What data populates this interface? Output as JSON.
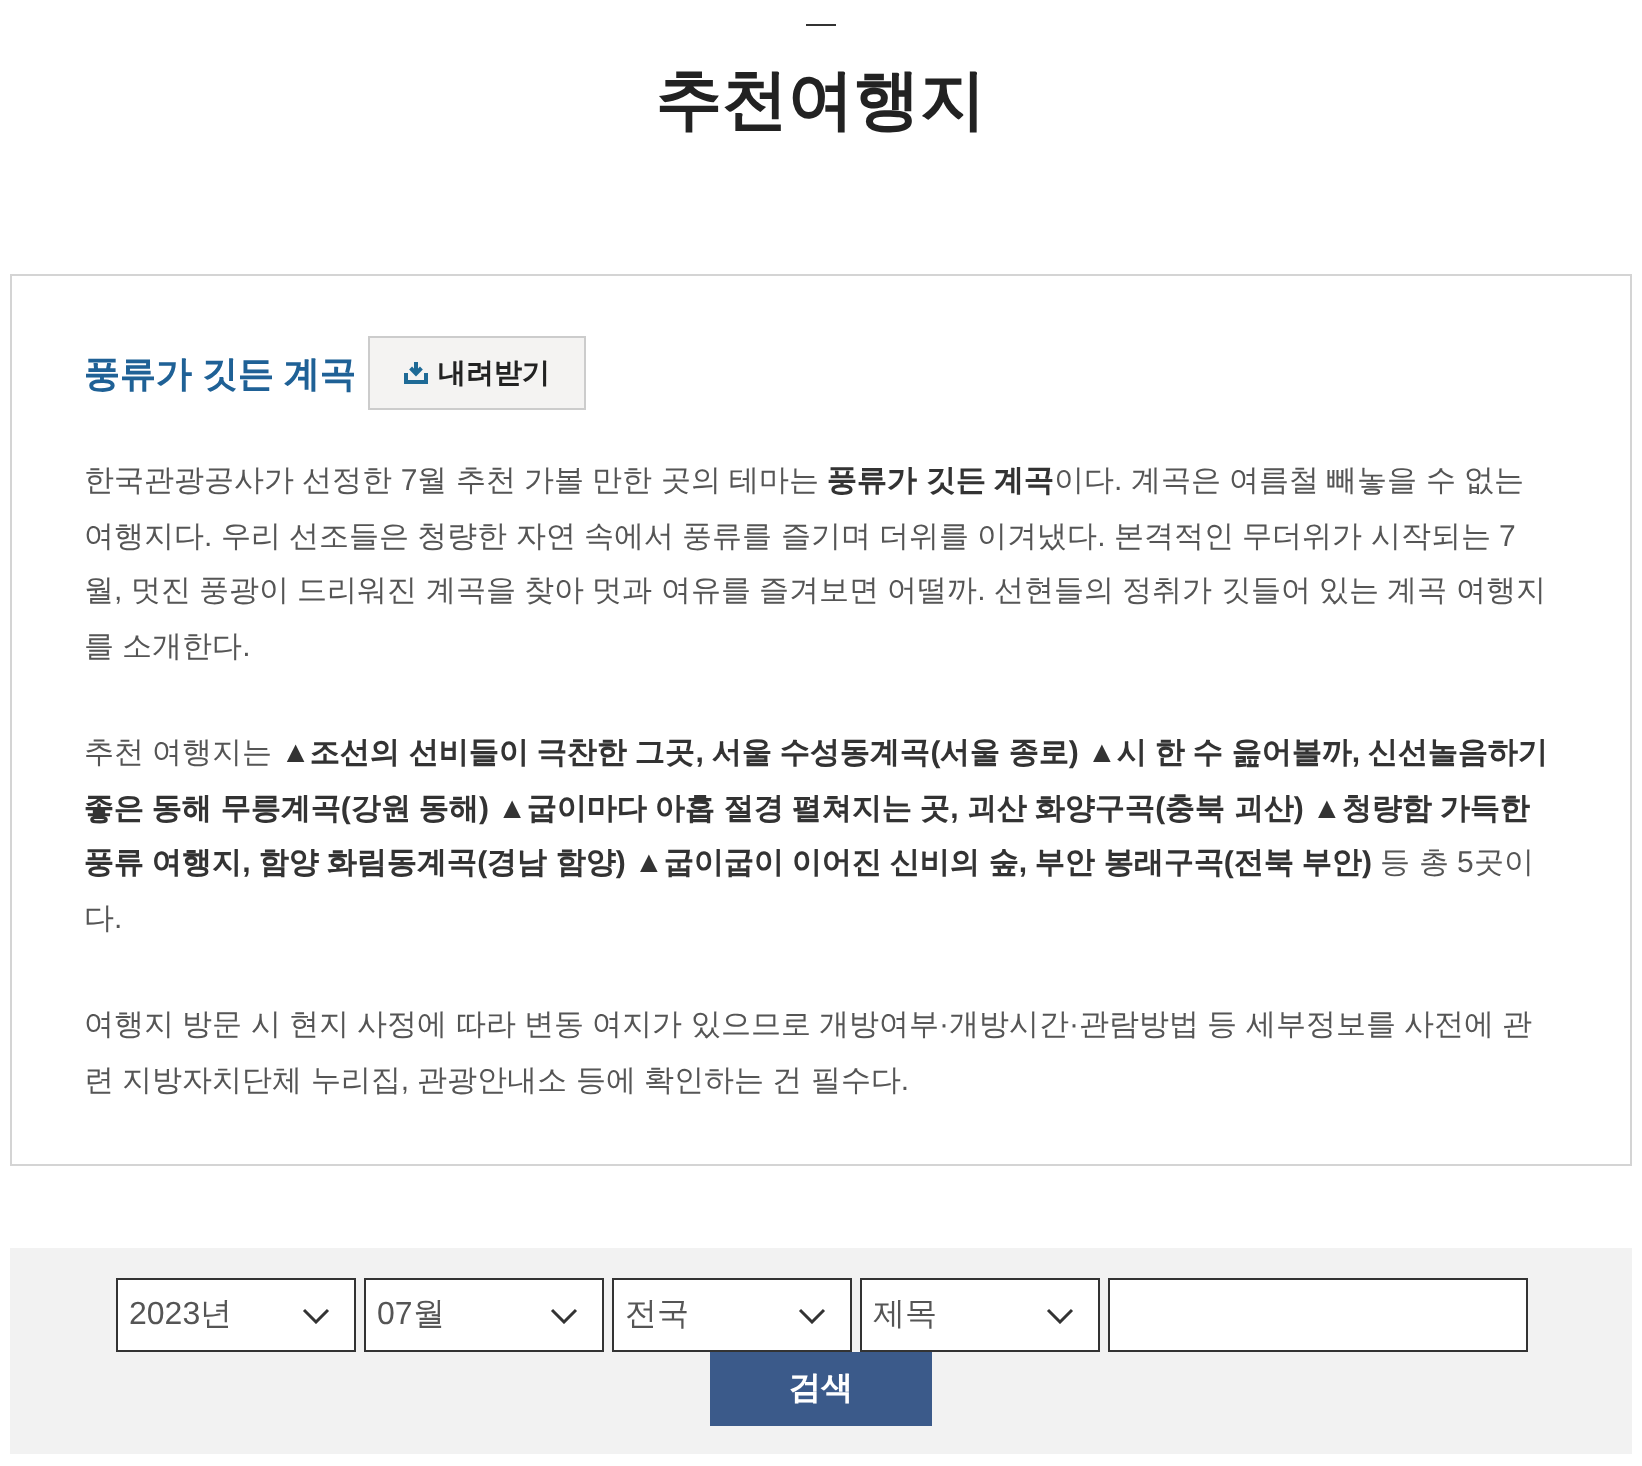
{
  "page": {
    "title": "추천여행지"
  },
  "article": {
    "heading": "풍류가 깃든 계곡",
    "download_button": "내려받기",
    "paragraphs": [
      "한국관광공사가 선정한 7월 추천 가볼 만한 곳의 테마는 **풍류가 깃든 계곡**이다. 계곡은 여름철 빼놓을 수 없는 여행지다. 우리 선조들은 청량한 자연 속에서 풍류를 즐기며 더위를 이겨냈다. 본격적인 무더위가 시작되는 7월, 멋진 풍광이 드리워진 계곡을 찾아 멋과 여유를 즐겨보면 어떨까. 선현들의 정취가 깃들어 있는 계곡 여행지를 소개한다.",
      "추천 여행지는 **▲조선의 선비들이 극찬한 그곳, 서울 수성동계곡(서울 종로) ▲시 한 수 읊어볼까, 신선놀음하기 좋은 동해 무릉계곡(강원 동해) ▲굽이마다 아홉 절경 펼쳐지는 곳, 괴산 화양구곡(충북 괴산) ▲청량함 가득한 풍류 여행지, 함양 화림동계곡(경남 함양) ▲굽이굽이 이어진 신비의 숲, 부안 봉래구곡(전북 부안)** 등 총 5곳이다.",
      "여행지 방문 시 현지 사정에 따라 변동 여지가 있으므로 개방여부·개방시간·관람방법 등 세부정보를 사전에 관련 지방자치단체 누리집, 관광안내소 등에 확인하는 건 필수다."
    ]
  },
  "search": {
    "dropdowns": [
      {
        "value": "2023년"
      },
      {
        "value": "07월"
      },
      {
        "value": "전국"
      },
      {
        "value": "제목"
      }
    ],
    "button": "검색"
  }
}
